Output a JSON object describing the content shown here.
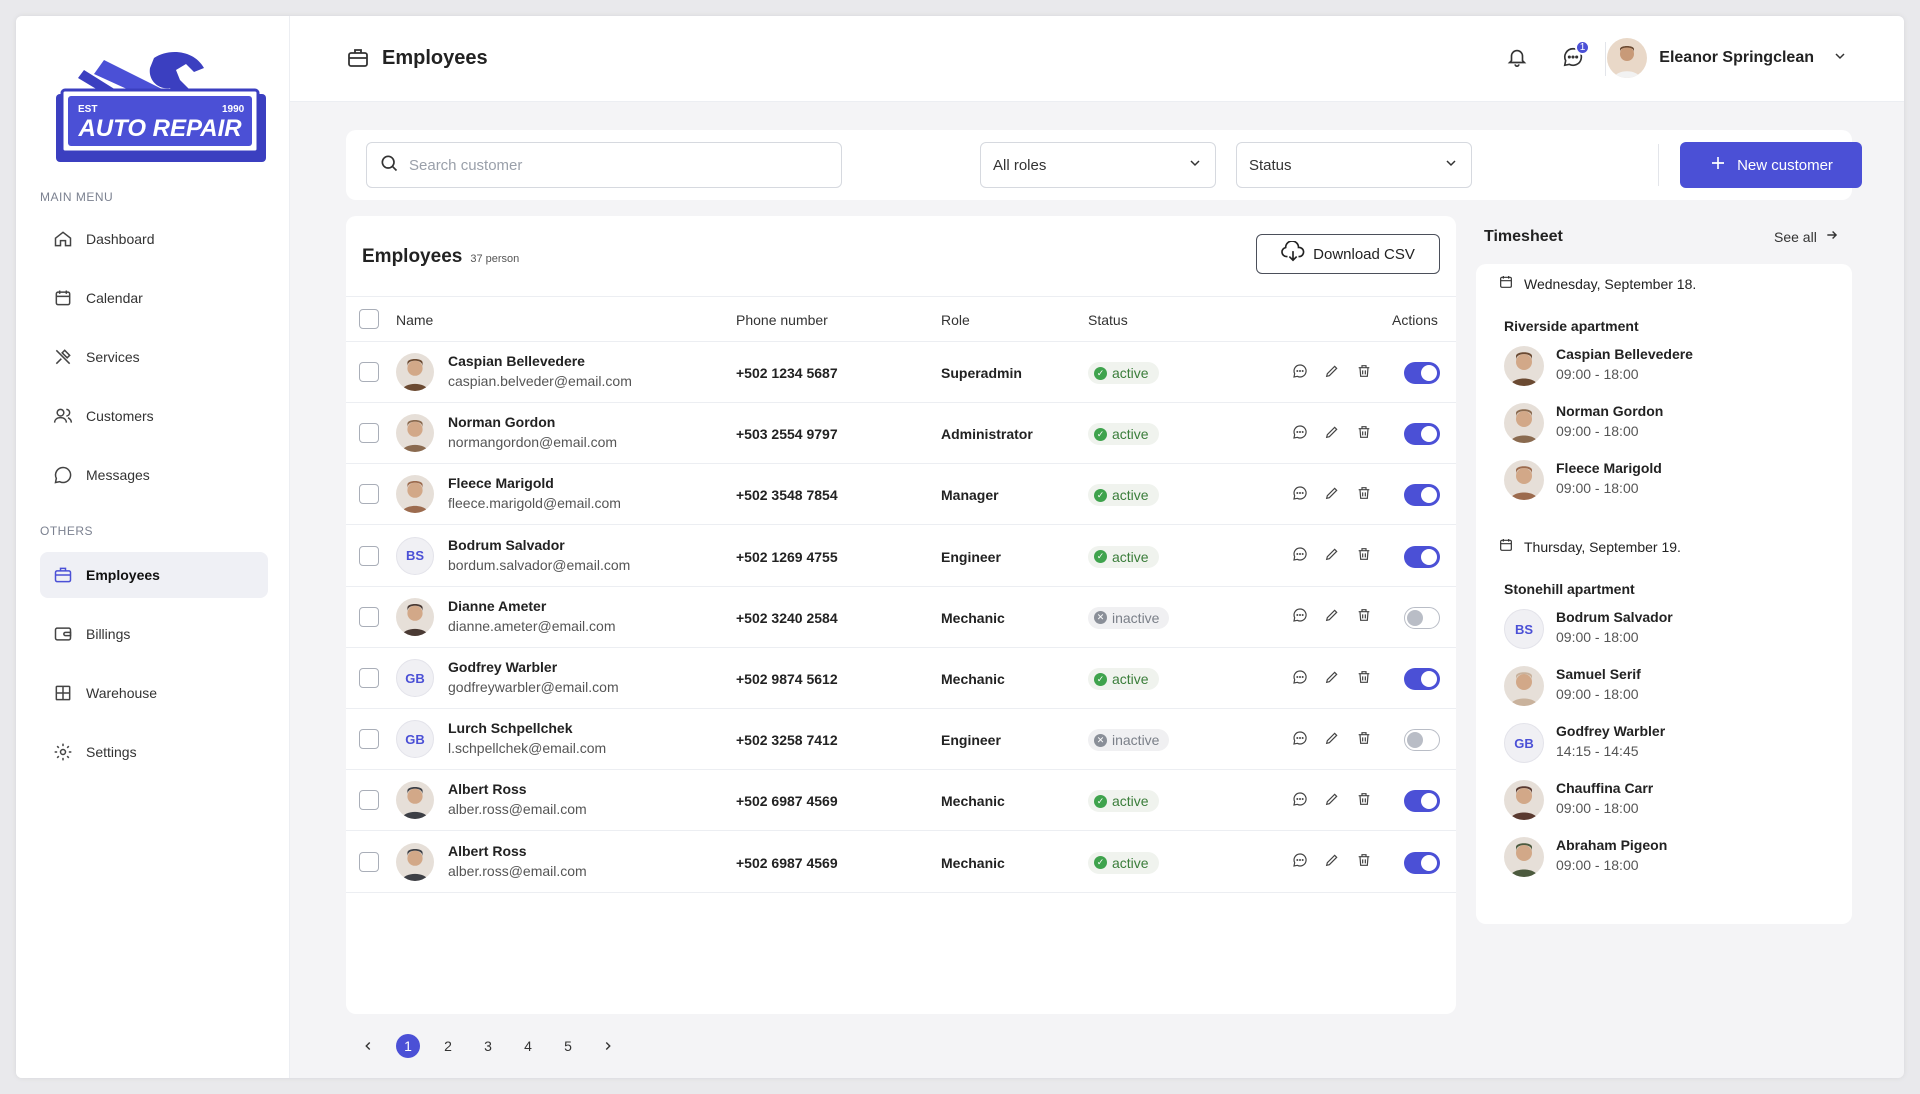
{
  "logo": {
    "est": "EST",
    "year": "1990",
    "text": "AUTO REPAIR"
  },
  "sidebar": {
    "main_menu_title": "MAIN MENU",
    "others_title": "OTHERS",
    "items": [
      {
        "label": "Dashboard",
        "icon": "home-icon"
      },
      {
        "label": "Calendar",
        "icon": "calendar-icon"
      },
      {
        "label": "Services",
        "icon": "tools-icon"
      },
      {
        "label": "Customers",
        "icon": "users-icon"
      },
      {
        "label": "Messages",
        "icon": "chat-icon"
      },
      {
        "label": "Employees",
        "icon": "briefcase-icon",
        "active": true
      },
      {
        "label": "Billings",
        "icon": "wallet-icon"
      },
      {
        "label": "Warehouse",
        "icon": "grid-icon"
      },
      {
        "label": "Settings",
        "icon": "gear-icon"
      }
    ]
  },
  "header": {
    "title": "Employees",
    "message_badge": "1",
    "user_name": "Eleanor Springclean"
  },
  "filters": {
    "search_placeholder": "Search customer",
    "roles_selected": "All roles",
    "status_selected": "Status",
    "new_button": "New customer"
  },
  "table": {
    "title": "Employees",
    "count": "37 person",
    "csv_button": "Download CSV",
    "columns": {
      "name": "Name",
      "phone": "Phone number",
      "role": "Role",
      "status": "Status",
      "actions": "Actions"
    },
    "rows": [
      {
        "name": "Caspian Bellevedere",
        "email": "caspian.belveder@email.com",
        "phone": "+502 1234 5687",
        "role": "Superadmin",
        "status": "active",
        "enabled": true,
        "initials": "",
        "avatar_color": "#6b4a32"
      },
      {
        "name": "Norman Gordon",
        "email": "normangordon@email.com",
        "phone": "+503 2554 9797",
        "role": "Administrator",
        "status": "active",
        "enabled": true,
        "initials": "",
        "avatar_color": "#8a6a4f"
      },
      {
        "name": "Fleece Marigold",
        "email": "fleece.marigold@email.com",
        "phone": "+502 3548 7854",
        "role": "Manager",
        "status": "active",
        "enabled": true,
        "initials": "",
        "avatar_color": "#9c6b4e"
      },
      {
        "name": "Bodrum Salvador",
        "email": "bordum.salvador@email.com",
        "phone": "+502 1269 4755",
        "role": "Engineer",
        "status": "active",
        "enabled": true,
        "initials": "BS",
        "avatar_color": ""
      },
      {
        "name": "Dianne Ameter",
        "email": "dianne.ameter@email.com",
        "phone": "+502 3240 2584",
        "role": "Mechanic",
        "status": "inactive",
        "enabled": false,
        "initials": "",
        "avatar_color": "#4a3a34"
      },
      {
        "name": "Godfrey Warbler",
        "email": "godfreywarbler@email.com",
        "phone": "+502 9874 5612",
        "role": "Mechanic",
        "status": "active",
        "enabled": true,
        "initials": "GB",
        "avatar_color": ""
      },
      {
        "name": "Lurch Schpellchek",
        "email": "l.schpellchek@email.com",
        "phone": "+502 3258 7412",
        "role": "Engineer",
        "status": "inactive",
        "enabled": false,
        "initials": "GB",
        "avatar_color": ""
      },
      {
        "name": "Albert Ross",
        "email": "alber.ross@email.com",
        "phone": "+502 6987 4569",
        "role": "Mechanic",
        "status": "active",
        "enabled": true,
        "initials": "",
        "avatar_color": "#3d3f45"
      },
      {
        "name": "Albert Ross",
        "email": "alber.ross@email.com",
        "phone": "+502 6987 4569",
        "role": "Mechanic",
        "status": "active",
        "enabled": true,
        "initials": "",
        "avatar_color": "#3d3f45"
      }
    ]
  },
  "pagination": {
    "pages": [
      "1",
      "2",
      "3",
      "4",
      "5"
    ],
    "current": "1"
  },
  "timesheet": {
    "title": "Timesheet",
    "see_all": "See all",
    "days": [
      {
        "date": "Wednesday, September 18.",
        "location": "Riverside apartment",
        "people": [
          {
            "name": "Caspian Bellevedere",
            "hours": "09:00 - 18:00",
            "initials": "",
            "avatar_color": "#6b4a32"
          },
          {
            "name": "Norman Gordon",
            "hours": "09:00 - 18:00",
            "initials": "",
            "avatar_color": "#8a6a4f"
          },
          {
            "name": "Fleece Marigold",
            "hours": "09:00 - 18:00",
            "initials": "",
            "avatar_color": "#9c6b4e"
          }
        ]
      },
      {
        "date": "Thursday, September 19.",
        "location": "Stonehill apartment",
        "people": [
          {
            "name": "Bodrum Salvador",
            "hours": "09:00 - 18:00",
            "initials": "BS",
            "avatar_color": ""
          },
          {
            "name": "Samuel Serif",
            "hours": "09:00 - 18:00",
            "initials": "",
            "avatar_color": "#c9b29c"
          },
          {
            "name": "Godfrey Warbler",
            "hours": "14:15 - 14:45",
            "initials": "GB",
            "avatar_color": ""
          },
          {
            "name": "Chauffina Carr",
            "hours": "09:00 - 18:00",
            "initials": "",
            "avatar_color": "#5a3a30"
          },
          {
            "name": "Abraham Pigeon",
            "hours": "09:00 - 18:00",
            "initials": "",
            "avatar_color": "#4c5a3e"
          }
        ]
      }
    ]
  },
  "colors": {
    "accent": "#4b50d6",
    "active_green": "#3fa34d",
    "inactive_gray": "#8a8f98"
  }
}
